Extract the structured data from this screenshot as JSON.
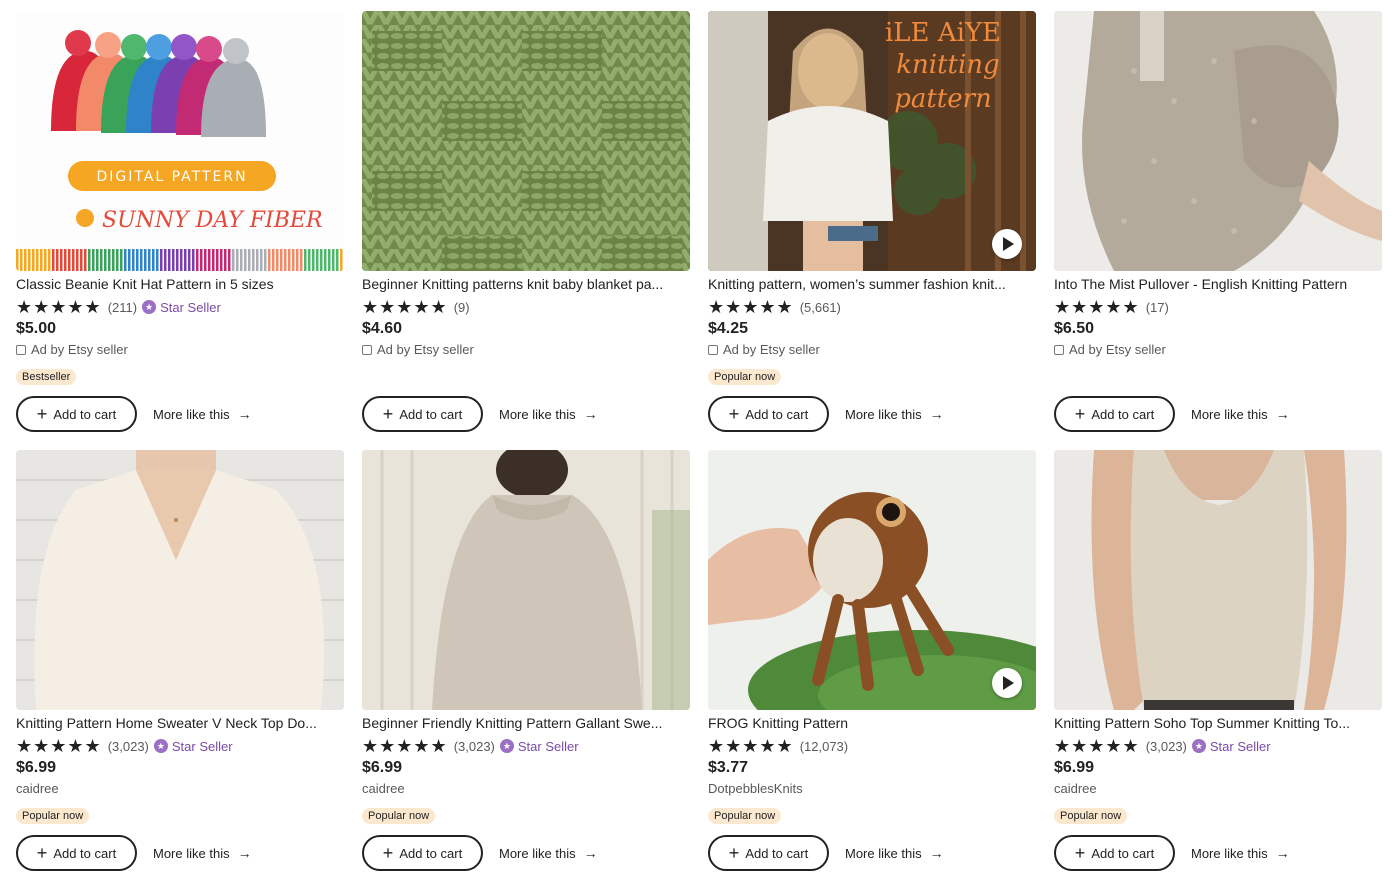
{
  "colors": {
    "star_seller": "#7B4BA6",
    "badge_bg": "#fce8cf",
    "text": "#222222",
    "muted": "#595959"
  },
  "listings": [
    {
      "title": "Classic Beanie Knit Hat Pattern in 5 sizes",
      "stars": "★★★★★",
      "count": "(211)",
      "star_seller": "Star Seller",
      "price": "$5.00",
      "seller": "Ad by Etsy seller",
      "is_ad": true,
      "badge": "Bestseller",
      "add_to_cart": "Add to cart",
      "more_like_this": "More like this",
      "image_text": [
        "DIGITAL PATTERN",
        "SUNNY DAY FIBER"
      ],
      "video": false
    },
    {
      "title": "Beginner Knitting patterns knit baby blanket pa...",
      "stars": "★★★★★",
      "count": "(9)",
      "star_seller": "",
      "price": "$4.60",
      "seller": "Ad by Etsy seller",
      "is_ad": true,
      "badge": "",
      "add_to_cart": "Add to cart",
      "more_like_this": "More like this",
      "image_text": [],
      "video": false
    },
    {
      "title": "Knitting pattern, women’s summer fashion knit...",
      "stars": "★★★★★",
      "count": "(5,661)",
      "star_seller": "",
      "price": "$4.25",
      "seller": "Ad by Etsy seller",
      "is_ad": true,
      "badge": "Popular now",
      "add_to_cart": "Add to cart",
      "more_like_this": "More like this",
      "image_text": [
        "iLE AiYE",
        "knitting",
        "pattern"
      ],
      "video": true
    },
    {
      "title": "Into The Mist Pullover - English Knitting Pattern",
      "stars": "★★★★★",
      "count": "(17)",
      "star_seller": "",
      "price": "$6.50",
      "seller": "Ad by Etsy seller",
      "is_ad": true,
      "badge": "",
      "add_to_cart": "Add to cart",
      "more_like_this": "More like this",
      "image_text": [],
      "video": false
    },
    {
      "title": "Knitting Pattern Home Sweater V Neck Top Do...",
      "stars": "★★★★★",
      "count": "(3,023)",
      "star_seller": "Star Seller",
      "price": "$6.99",
      "seller": "caidree",
      "is_ad": false,
      "badge": "Popular now",
      "add_to_cart": "Add to cart",
      "more_like_this": "More like this",
      "image_text": [],
      "video": false
    },
    {
      "title": "Beginner Friendly Knitting Pattern Gallant Swe...",
      "stars": "★★★★★",
      "count": "(3,023)",
      "star_seller": "Star Seller",
      "price": "$6.99",
      "seller": "caidree",
      "is_ad": false,
      "badge": "Popular now",
      "add_to_cart": "Add to cart",
      "more_like_this": "More like this",
      "image_text": [],
      "video": false
    },
    {
      "title": "FROG Knitting Pattern",
      "stars": "★★★★★",
      "count": "(12,073)",
      "star_seller": "",
      "price": "$3.77",
      "seller": "DotpebblesKnits",
      "is_ad": false,
      "badge": "Popular now",
      "add_to_cart": "Add to cart",
      "more_like_this": "More like this",
      "image_text": [],
      "video": true
    },
    {
      "title": "Knitting Pattern Soho Top Summer Knitting To...",
      "stars": "★★★★★",
      "count": "(3,023)",
      "star_seller": "Star Seller",
      "price": "$6.99",
      "seller": "caidree",
      "is_ad": false,
      "badge": "Popular now",
      "add_to_cart": "Add to cart",
      "more_like_this": "More like this",
      "image_text": [],
      "video": false
    }
  ]
}
